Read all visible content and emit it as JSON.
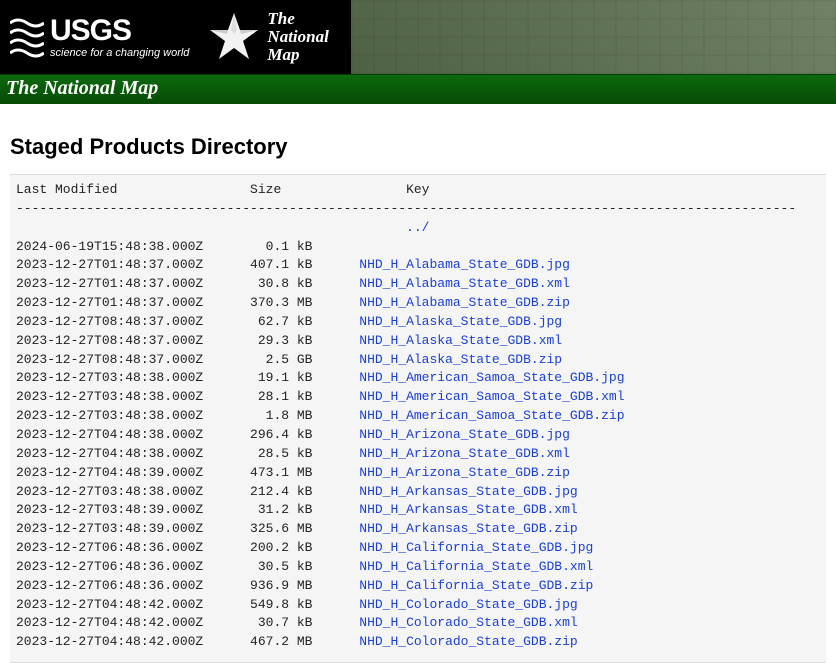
{
  "banner": {
    "usgs_main": "USGS",
    "usgs_tag": "science for a changing world",
    "tnm_line1": "The",
    "tnm_line2": "National",
    "tnm_line3": "Map"
  },
  "greenbar": "The National Map",
  "page_title": "Staged Products Directory",
  "headers": {
    "last_modified": "Last Modified",
    "size": "Size",
    "key": "Key"
  },
  "parent_link": "../",
  "rows": [
    {
      "modified": "2024-06-19T15:48:38.000Z",
      "size": "0.1 kB",
      "key": ""
    },
    {
      "modified": "2023-12-27T01:48:37.000Z",
      "size": "407.1 kB",
      "key": "NHD_H_Alabama_State_GDB.jpg"
    },
    {
      "modified": "2023-12-27T01:48:37.000Z",
      "size": "30.8 kB",
      "key": "NHD_H_Alabama_State_GDB.xml"
    },
    {
      "modified": "2023-12-27T01:48:37.000Z",
      "size": "370.3 MB",
      "key": "NHD_H_Alabama_State_GDB.zip"
    },
    {
      "modified": "2023-12-27T08:48:37.000Z",
      "size": "62.7 kB",
      "key": "NHD_H_Alaska_State_GDB.jpg"
    },
    {
      "modified": "2023-12-27T08:48:37.000Z",
      "size": "29.3 kB",
      "key": "NHD_H_Alaska_State_GDB.xml"
    },
    {
      "modified": "2023-12-27T08:48:37.000Z",
      "size": "2.5 GB",
      "key": "NHD_H_Alaska_State_GDB.zip"
    },
    {
      "modified": "2023-12-27T03:48:38.000Z",
      "size": "19.1 kB",
      "key": "NHD_H_American_Samoa_State_GDB.jpg"
    },
    {
      "modified": "2023-12-27T03:48:38.000Z",
      "size": "28.1 kB",
      "key": "NHD_H_American_Samoa_State_GDB.xml"
    },
    {
      "modified": "2023-12-27T03:48:38.000Z",
      "size": "1.8 MB",
      "key": "NHD_H_American_Samoa_State_GDB.zip"
    },
    {
      "modified": "2023-12-27T04:48:38.000Z",
      "size": "296.4 kB",
      "key": "NHD_H_Arizona_State_GDB.jpg"
    },
    {
      "modified": "2023-12-27T04:48:38.000Z",
      "size": "28.5 kB",
      "key": "NHD_H_Arizona_State_GDB.xml"
    },
    {
      "modified": "2023-12-27T04:48:39.000Z",
      "size": "473.1 MB",
      "key": "NHD_H_Arizona_State_GDB.zip"
    },
    {
      "modified": "2023-12-27T03:48:38.000Z",
      "size": "212.4 kB",
      "key": "NHD_H_Arkansas_State_GDB.jpg"
    },
    {
      "modified": "2023-12-27T03:48:39.000Z",
      "size": "31.2 kB",
      "key": "NHD_H_Arkansas_State_GDB.xml"
    },
    {
      "modified": "2023-12-27T03:48:39.000Z",
      "size": "325.6 MB",
      "key": "NHD_H_Arkansas_State_GDB.zip"
    },
    {
      "modified": "2023-12-27T06:48:36.000Z",
      "size": "200.2 kB",
      "key": "NHD_H_California_State_GDB.jpg"
    },
    {
      "modified": "2023-12-27T06:48:36.000Z",
      "size": "30.5 kB",
      "key": "NHD_H_California_State_GDB.xml"
    },
    {
      "modified": "2023-12-27T06:48:36.000Z",
      "size": "936.9 MB",
      "key": "NHD_H_California_State_GDB.zip"
    },
    {
      "modified": "2023-12-27T04:48:42.000Z",
      "size": "549.8 kB",
      "key": "NHD_H_Colorado_State_GDB.jpg"
    },
    {
      "modified": "2023-12-27T04:48:42.000Z",
      "size": "30.7 kB",
      "key": "NHD_H_Colorado_State_GDB.xml"
    },
    {
      "modified": "2023-12-27T04:48:42.000Z",
      "size": "467.2 MB",
      "key": "NHD_H_Colorado_State_GDB.zip"
    }
  ]
}
